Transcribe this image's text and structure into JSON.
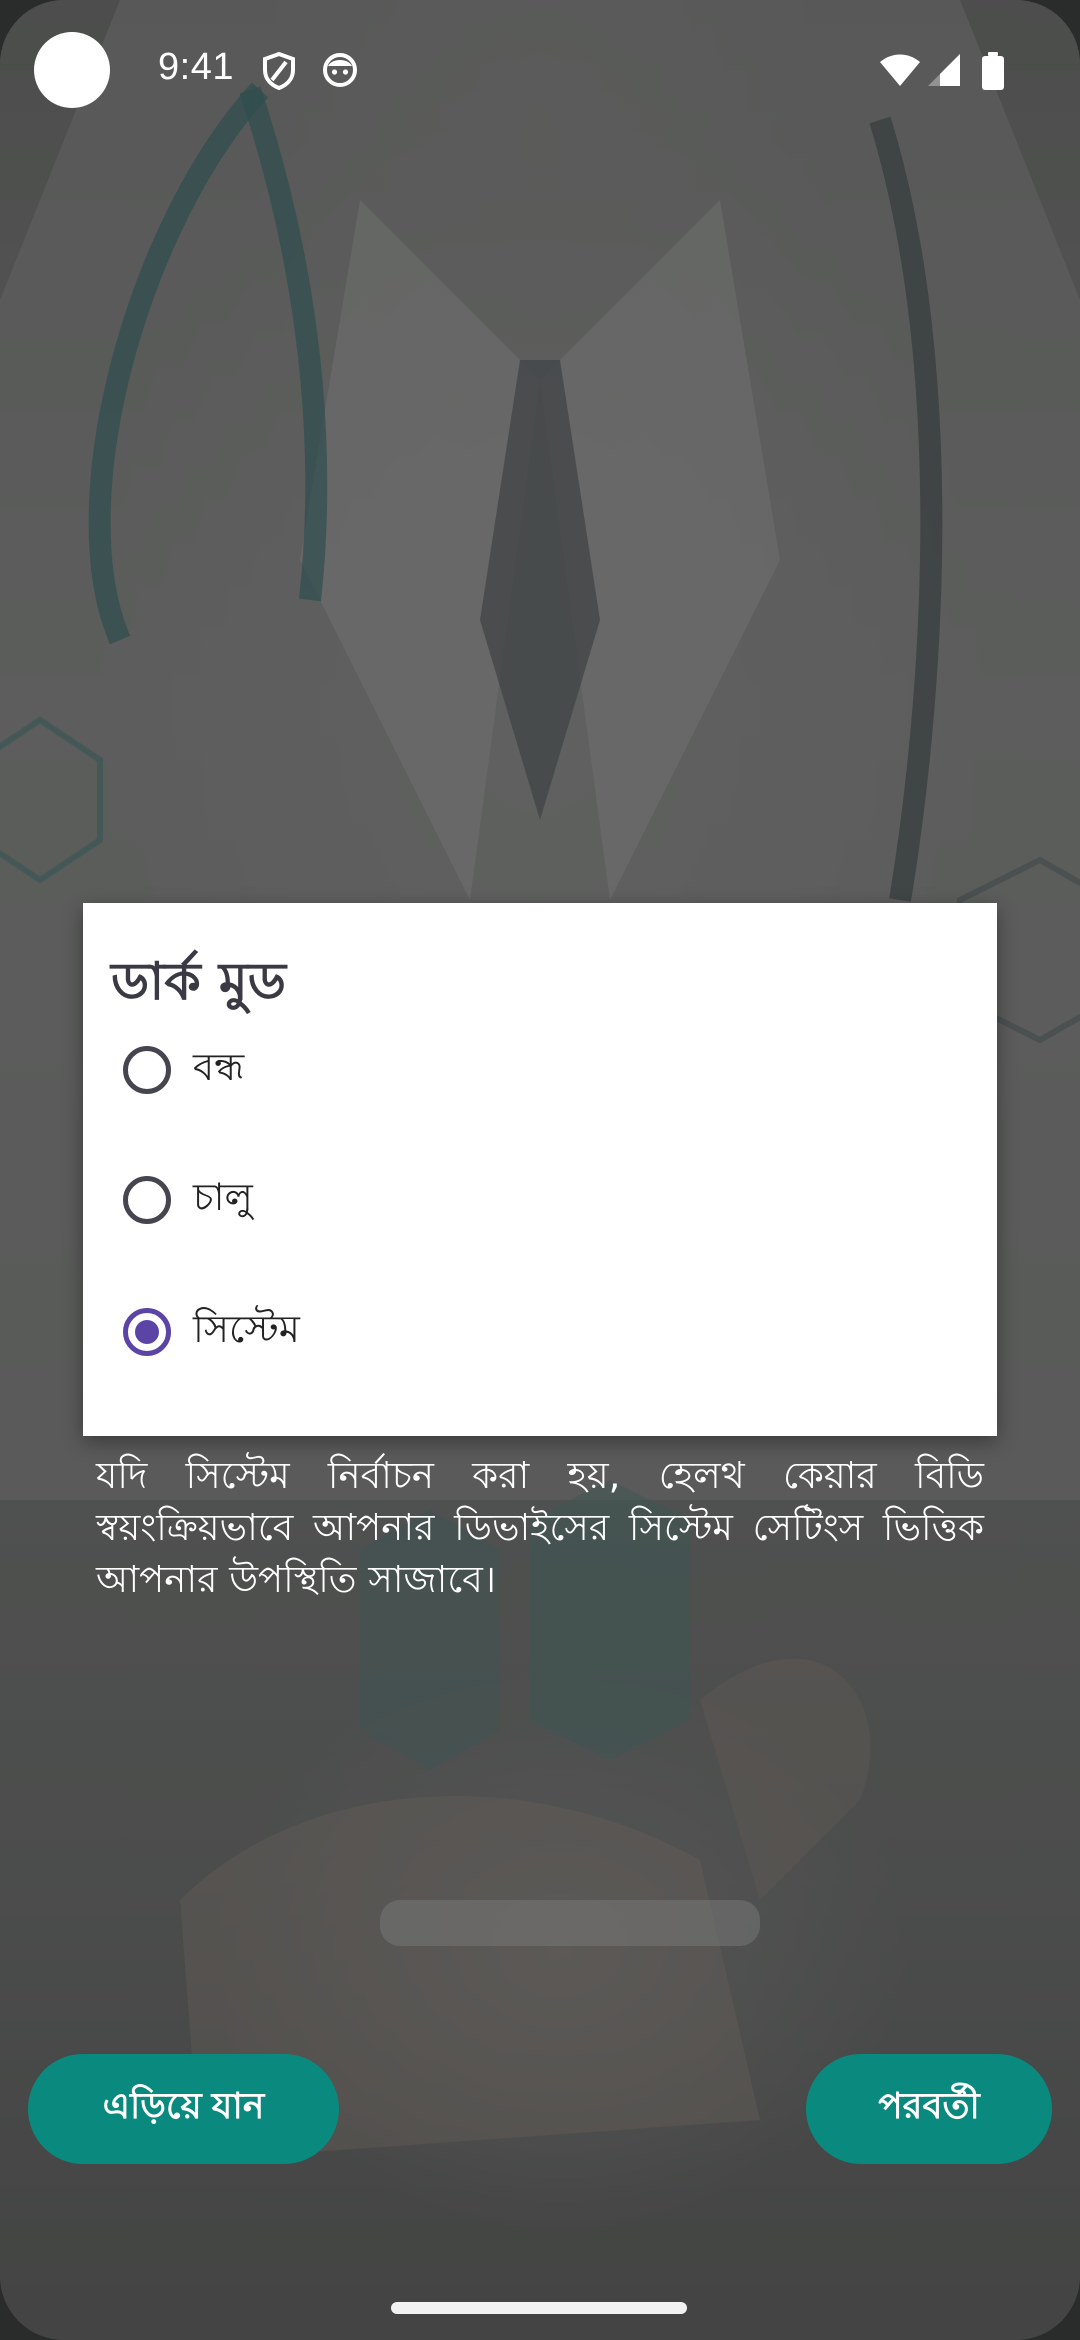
{
  "status_bar": {
    "time": "9:41"
  },
  "dialog": {
    "title": "ডার্ক মুড",
    "options": [
      {
        "label": "বন্ধ",
        "selected": false
      },
      {
        "label": "চালু",
        "selected": false
      },
      {
        "label": "সিস্টেম",
        "selected": true
      }
    ]
  },
  "description": "যদি সিস্টেম নির্বাচন করা হয়, হেলথ কেয়ার বিডি স্বয়ংক্রিয়ভাবে আপনার ডিভাইসের সিস্টেম সেটিংস ভিত্তিক আপনার উপস্থিতি সাজাবে।",
  "buttons": {
    "skip_label": "এড়িয়ে যান",
    "next_label": "পরবর্তী"
  },
  "colors": {
    "accent": "#0a8a7e",
    "radio_selected": "#5c44a6"
  }
}
